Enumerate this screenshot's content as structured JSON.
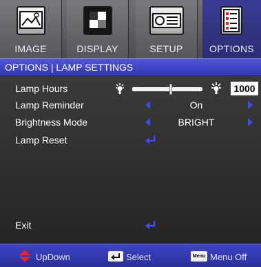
{
  "tabs": [
    {
      "label": "IMAGE",
      "icon": "image-icon"
    },
    {
      "label": "DISPLAY",
      "icon": "display-icon"
    },
    {
      "label": "SETUP",
      "icon": "projector-icon"
    },
    {
      "label": "OPTIONS",
      "icon": "options-icon"
    }
  ],
  "active_tab": "OPTIONS",
  "header": {
    "title": "OPTIONS | LAMP SETTINGS"
  },
  "rows": {
    "lamp_hours": {
      "label": "Lamp Hours",
      "value": "1000",
      "slider_fraction": 0.55
    },
    "lamp_reminder": {
      "label": "Lamp Reminder",
      "value": "On"
    },
    "brightness_mode": {
      "label": "Brightness Mode",
      "value": "BRIGHT"
    },
    "lamp_reset": {
      "label": "Lamp Reset"
    },
    "exit": {
      "label": "Exit"
    }
  },
  "footer": {
    "updown": "UpDown",
    "select": "Select",
    "menu_glyph": "Menu",
    "menu_off": "Menu Off"
  },
  "colors": {
    "accent": "#3d4bf0",
    "header": "#4046c8",
    "footer": "#3439b0",
    "updown_arrow": "#e8232b"
  }
}
